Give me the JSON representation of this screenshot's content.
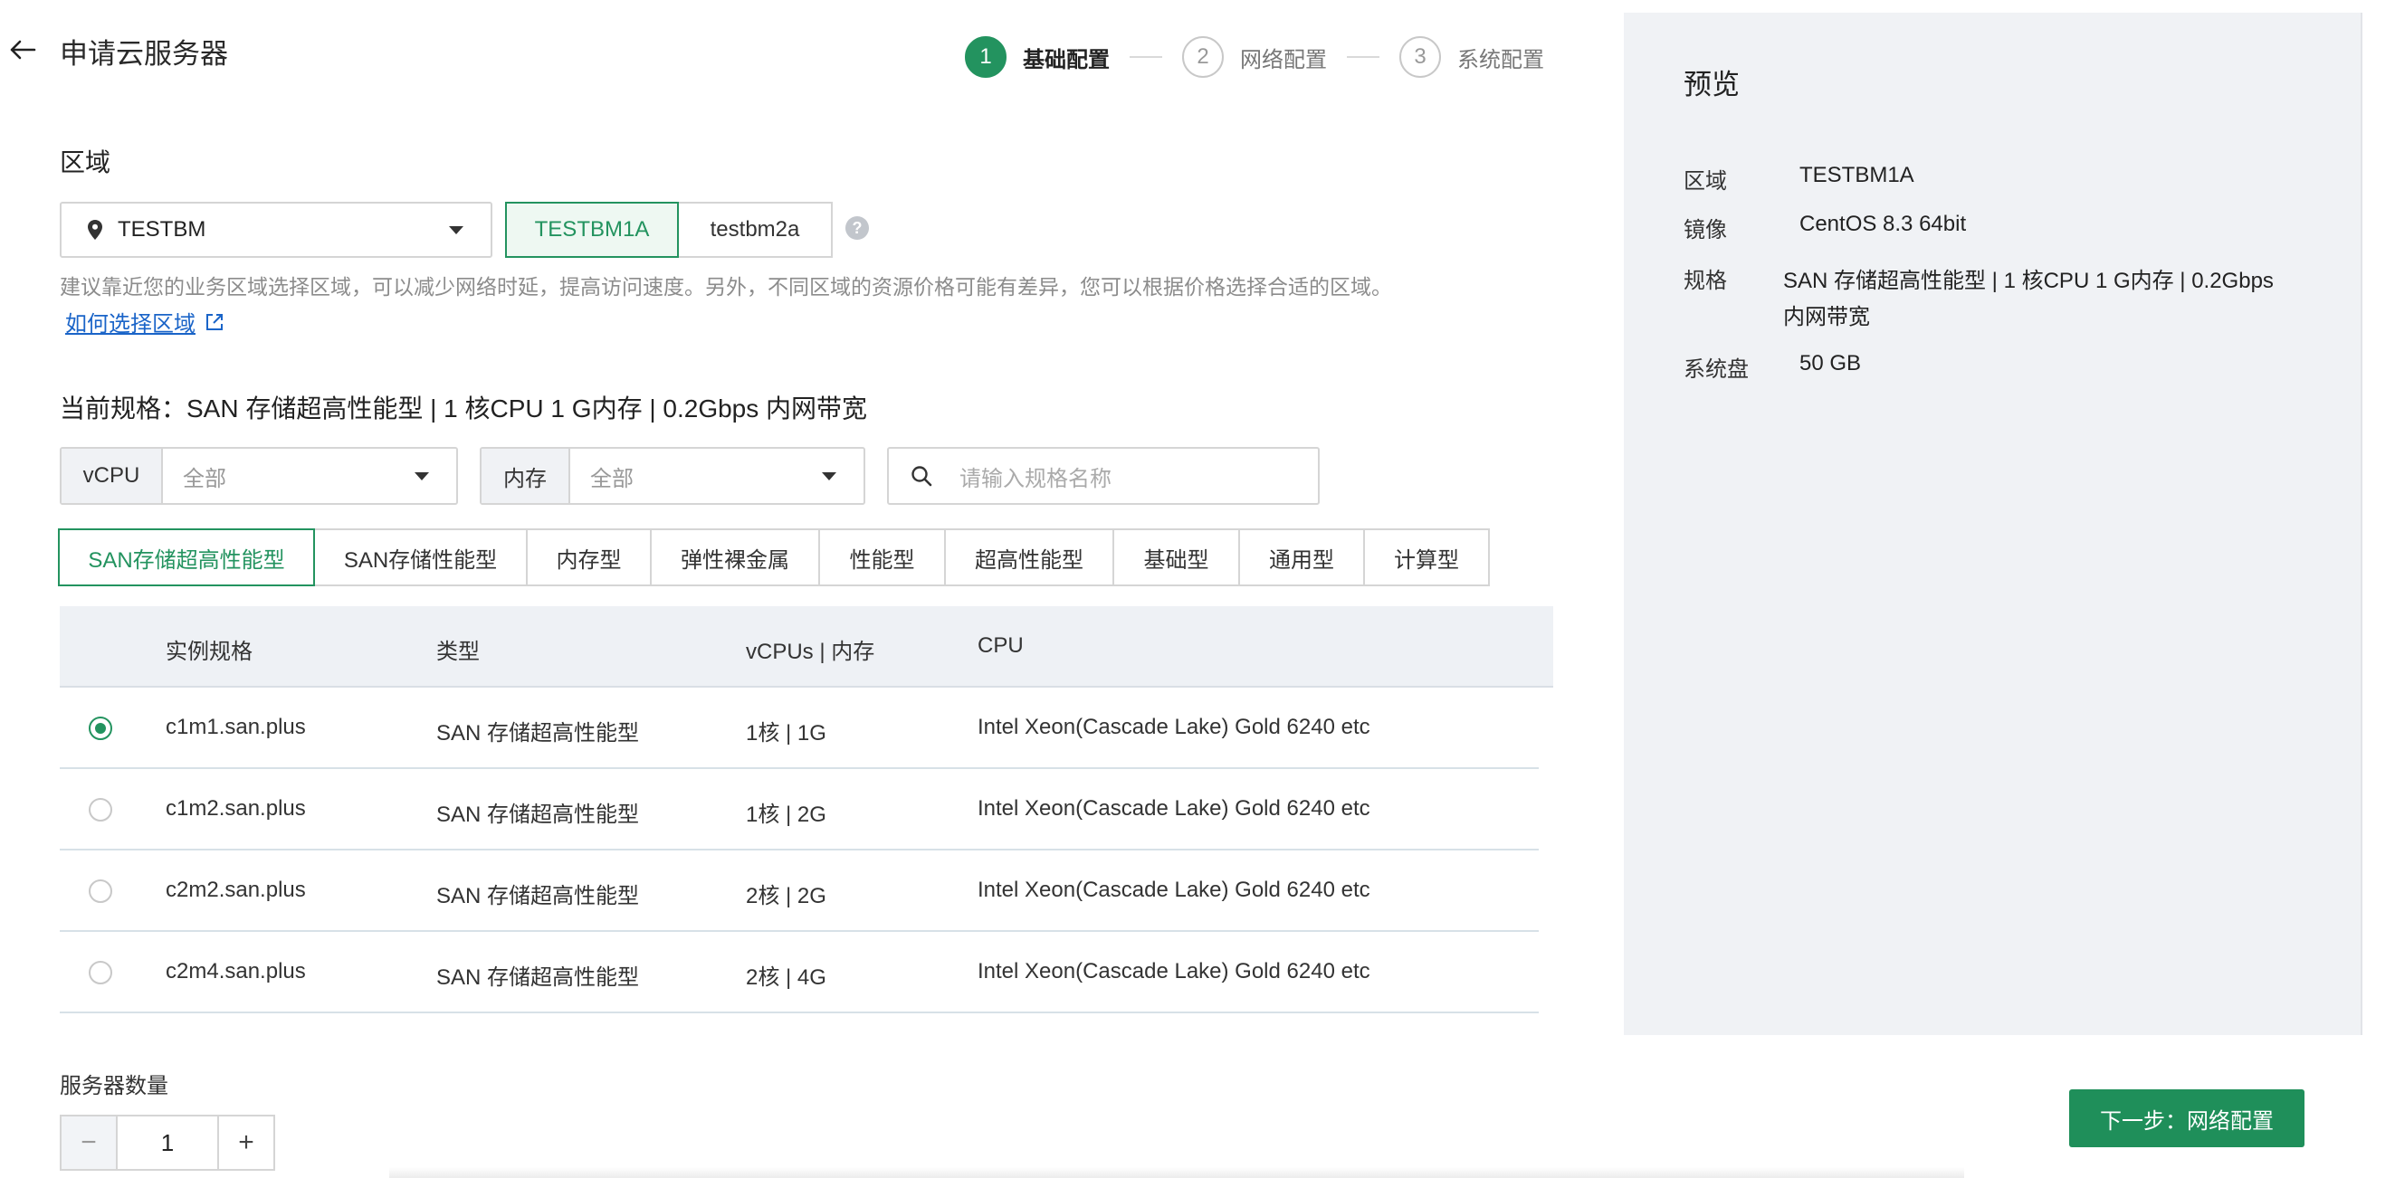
{
  "header": {
    "title": "申请云服务器",
    "steps": [
      {
        "num": "1",
        "label": "基础配置"
      },
      {
        "num": "2",
        "label": "网络配置"
      },
      {
        "num": "3",
        "label": "系统配置"
      }
    ]
  },
  "region": {
    "title": "区域",
    "selected": "TESTBM",
    "zones": [
      "TESTBM1A",
      "testbm2a"
    ],
    "help": "?",
    "hint": "建议靠近您的业务区域选择区域，可以减少网络时延，提高访问速度。另外，不同区域的资源价格可能有差异，您可以根据价格选择合适的区域。",
    "link": "如何选择区域"
  },
  "spec": {
    "current": "当前规格：SAN 存储超高性能型 | 1 核CPU 1 G内存 | 0.2Gbps 内网带宽",
    "filters": {
      "vcpu_label": "vCPU",
      "vcpu_value": "全部",
      "mem_label": "内存",
      "mem_value": "全部",
      "search_placeholder": "请输入规格名称"
    },
    "tabs": [
      "SAN存储超高性能型",
      "SAN存储性能型",
      "内存型",
      "弹性裸金属",
      "性能型",
      "超高性能型",
      "基础型",
      "通用型",
      "计算型"
    ],
    "table": {
      "headers": [
        "实例规格",
        "类型",
        "vCPUs | 内存",
        "CPU"
      ],
      "rows": [
        {
          "name": "c1m1.san.plus",
          "type": "SAN 存储超高性能型",
          "vm": "1核 | 1G",
          "cpu": "Intel Xeon(Cascade Lake) Gold 6240 etc"
        },
        {
          "name": "c1m2.san.plus",
          "type": "SAN 存储超高性能型",
          "vm": "1核 | 2G",
          "cpu": "Intel Xeon(Cascade Lake) Gold 6240 etc"
        },
        {
          "name": "c2m2.san.plus",
          "type": "SAN 存储超高性能型",
          "vm": "2核 | 2G",
          "cpu": "Intel Xeon(Cascade Lake) Gold 6240 etc"
        },
        {
          "name": "c2m4.san.plus",
          "type": "SAN 存储超高性能型",
          "vm": "2核 | 4G",
          "cpu": "Intel Xeon(Cascade Lake) Gold 6240 etc"
        }
      ]
    }
  },
  "preview": {
    "title": "预览",
    "items": [
      {
        "label": "区域",
        "value": "TESTBM1A"
      },
      {
        "label": "镜像",
        "value": "CentOS 8.3 64bit"
      },
      {
        "label": "规格",
        "value": "SAN 存储超高性能型 | 1 核CPU 1 G内存 | 0.2Gbps",
        "value2": "内网带宽"
      },
      {
        "label": "系统盘",
        "value": "50 GB"
      }
    ]
  },
  "footer": {
    "count_label": "服务器数量",
    "minus": "−",
    "count": "1",
    "plus": "+",
    "next_button": "下一步：网络配置"
  },
  "colors": {
    "accent": "#23935f",
    "link": "#1a64c8",
    "panel": "#f0f2f5"
  }
}
